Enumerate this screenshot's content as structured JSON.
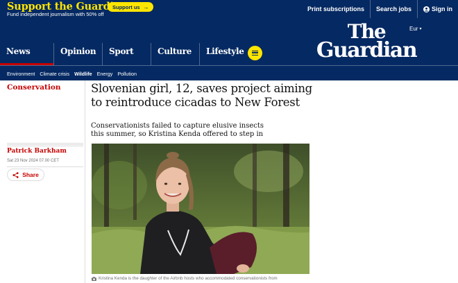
{
  "support": {
    "title": "Support the Guardian",
    "subtitle": "Fund independent journalism with 50% off",
    "button_label": "Support us",
    "button_icon": "arrow-right-icon"
  },
  "top_links": {
    "print": "Print subscriptions",
    "jobs": "Search jobs",
    "signin": "Sign in",
    "signin_icon": "account-icon"
  },
  "edition": {
    "label": "Eur",
    "chevron": "▾"
  },
  "logo": {
    "line1": "The",
    "line2": "Guardian"
  },
  "pillars": [
    {
      "label": "News",
      "active": true
    },
    {
      "label": "Opinion",
      "active": false
    },
    {
      "label": "Sport",
      "active": false
    },
    {
      "label": "Culture",
      "active": false
    },
    {
      "label": "Lifestyle",
      "active": false
    }
  ],
  "subnav": [
    {
      "label": "Environment"
    },
    {
      "label": "Climate crisis"
    },
    {
      "label": "Wildlife",
      "current": true
    },
    {
      "label": "Energy"
    },
    {
      "label": "Pollution"
    }
  ],
  "article": {
    "section": "Conservation",
    "headline": "Slovenian girl, 12, saves project aiming to reintroduce cicadas to New Forest",
    "standfirst": "Conservationists failed to capture elusive insects this summer, so Kristina Kenda offered to step in",
    "byline": "Patrick Barkham",
    "date": "Sat 23 Nov 2024 07.00 CET",
    "share_label": "Share",
    "caption": "Kristina Kenda is the daughter of the Airbnb hosts who accommodated conservationists from"
  },
  "colors": {
    "brand_blue": "#052962",
    "support_yellow": "#ffe500",
    "news_red": "#c70000"
  }
}
